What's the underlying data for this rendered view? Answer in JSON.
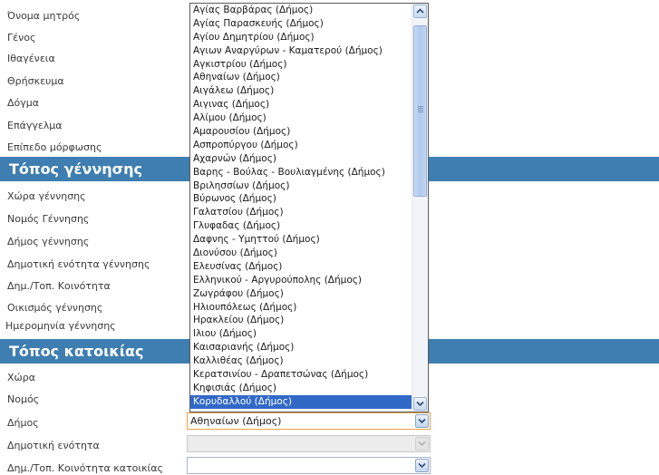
{
  "labels": {
    "mother_name": "Όνομα μητρός",
    "gender": "Γένος",
    "nationality": "Ιθαγένεια",
    "religion": "Θρήσκευμα",
    "dogma": "Δόγμα",
    "profession": "Επάγγελμα",
    "education": "Επίπεδο μόρφωσης",
    "birth_country": "Χώρα γέννησης",
    "birth_prefecture": "Νομός Γέννησης",
    "birth_municipality": "Δήμος γέννησης",
    "birth_municipal_unit": "Δημοτική ενότητα γέννησης",
    "birth_community": "Δημ./Τοπ. Κοινότητα",
    "birth_settlement": "Οικισμός γέννησης",
    "birth_date": "Ημερομηνία γέννησης",
    "residence_country": "Χώρα",
    "residence_prefecture": "Νομός",
    "residence_municipality": "Δήμος",
    "residence_municipal_unit": "Δημοτική ενότητα",
    "residence_community": "Δημ./Τοπ. Κοινότητα κατοικίας"
  },
  "sections": {
    "birth_place": "Τόπος γέννησης",
    "residence": "Τόπος κατοικίας"
  },
  "municipality_select": {
    "value": "Αθηναίων (Δήμος)",
    "options": [
      "Αγίας Βαρβάρας (Δήμος)",
      "Αγίας Παρασκευής (Δήμος)",
      "Αγίου Δημητρίου (Δήμος)",
      "Αγιων Αναργύρων - Καματερού (Δήμος)",
      "Αγκιστρίου (Δήμος)",
      "Αθηναίων (Δήμος)",
      "Αιγάλεω (Δήμος)",
      "Αιγινας (Δήμος)",
      "Αλίμου (Δήμος)",
      "Αμαρουσίου (Δήμος)",
      "Ασπροπύργου (Δήμος)",
      "Αχαρνών (Δήμος)",
      "Βαρης - Βούλας - Βουλιαγμένης (Δήμος)",
      "Βριλησσίων (Δήμος)",
      "Βύρωνος (Δήμος)",
      "Γαλατσίου (Δήμος)",
      "Γλυφαδας (Δήμος)",
      "Δαφνης - Υμηττού (Δήμος)",
      "Διονύσου (Δήμος)",
      "Ελευσίνας (Δήμος)",
      "Ελληνικού - Αργυρούπολης (Δήμος)",
      "Ζωγράφου (Δήμος)",
      "Ηλιουπόλεως (Δήμος)",
      "Ηρακλείου (Δήμος)",
      "Ιλιου (Δήμος)",
      "Καισαριανής (Δήμος)",
      "Καλλιθέας (Δήμος)",
      "Κερατσινίου - Δραπετσώνας (Δήμος)",
      "Κηφισιάς (Δήμος)",
      "Κορυδαλλού (Δήμος)"
    ],
    "highlighted": "Κορυδαλλού (Δήμος)"
  },
  "colors": {
    "section_bar": "#3e7eb0",
    "highlight": "#3169c6",
    "focus_border": "#e7a14a"
  },
  "icons": {
    "dropdown": "chevron-down-icon",
    "scroll_up": "chevron-up-icon",
    "scroll_down": "chevron-down-icon"
  }
}
